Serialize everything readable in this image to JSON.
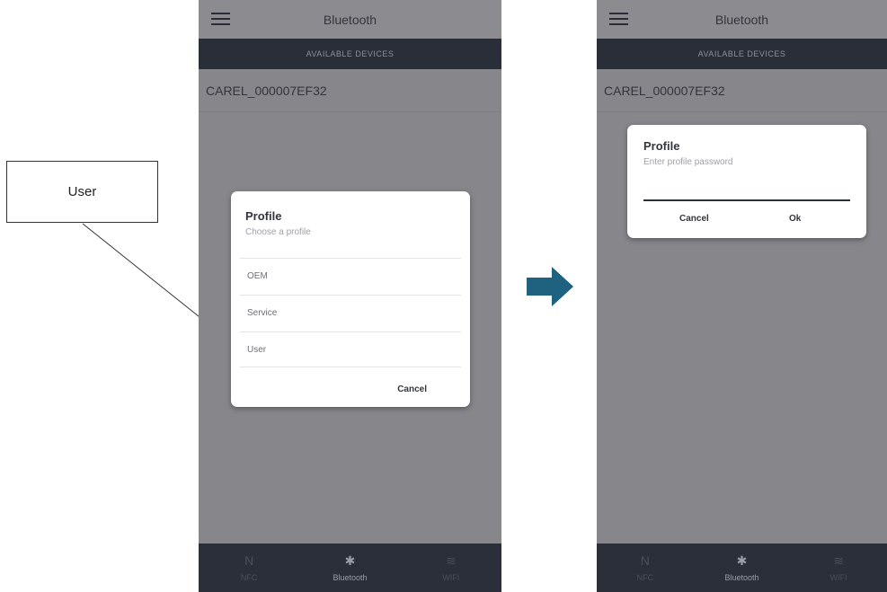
{
  "callout": {
    "label": "User"
  },
  "left_screen": {
    "title": "Bluetooth",
    "section_header": "AVAILABLE DEVICES",
    "device": "CAREL_000007EF32",
    "dialog": {
      "title": "Profile",
      "subtitle": "Choose a profile",
      "options": [
        "OEM",
        "Service",
        "User"
      ],
      "cancel_label": "Cancel"
    },
    "nav": [
      {
        "icon": "N",
        "label": "NFC",
        "icon_name": "nfc-icon"
      },
      {
        "icon": "✱",
        "label": "Bluetooth",
        "icon_name": "bluetooth-icon"
      },
      {
        "icon": "≋",
        "label": "WIFI",
        "icon_name": "wifi-icon"
      }
    ]
  },
  "right_screen": {
    "title": "Bluetooth",
    "section_header": "AVAILABLE DEVICES",
    "device": "CAREL_000007EF32",
    "dialog": {
      "title": "Profile",
      "subtitle": "Enter profile password",
      "password_value": "",
      "cancel_label": "Cancel",
      "ok_label": "Ok"
    },
    "nav": [
      {
        "icon": "N",
        "label": "NFC",
        "icon_name": "nfc-icon"
      },
      {
        "icon": "✱",
        "label": "Bluetooth",
        "icon_name": "bluetooth-icon"
      },
      {
        "icon": "≋",
        "label": "WIFI",
        "icon_name": "wifi-icon"
      }
    ]
  },
  "colors": {
    "screen_bg": "#86868b",
    "header_dark": "#2a2e38",
    "dialog_bg": "#ffffff",
    "arrow": "#1f6280"
  }
}
